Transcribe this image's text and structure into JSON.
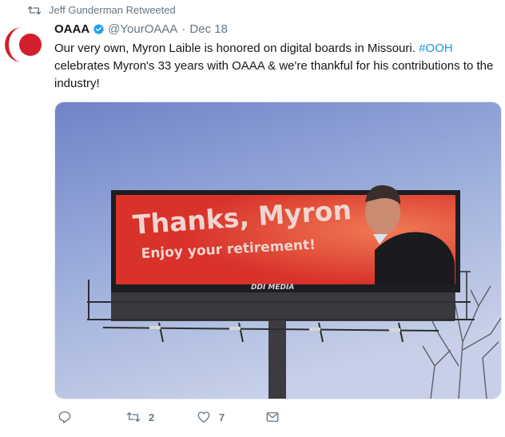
{
  "retweet_banner": {
    "icon": "retweet-icon",
    "text": "Jeff Gunderman Retweeted"
  },
  "tweet": {
    "author_name": "OAAA",
    "verified": true,
    "handle": "@YourOAAA",
    "separator": "·",
    "date": "Dec 18",
    "text_part1": "Our very own, Myron Laible is honored on digital boards in Missouri. ",
    "hashtag": "#OOH",
    "text_part2": " celebrates Myron's 33 years with OAAA & we're thankful for his contributions to the industry!",
    "image": {
      "billboard_title": "Thanks, Myron",
      "billboard_subtitle": "Enjoy your retirement!",
      "vendor_logo": "DDI MEDIA"
    }
  },
  "actions": {
    "reply": {
      "icon": "reply-icon",
      "count": ""
    },
    "retweet": {
      "icon": "retweet-icon",
      "count": "2"
    },
    "like": {
      "icon": "heart-icon",
      "count": "7"
    },
    "dm": {
      "icon": "envelope-icon",
      "count": ""
    }
  },
  "colors": {
    "accent": "#1b95e0",
    "muted": "#657786",
    "billboard_red": "#d8322a"
  }
}
